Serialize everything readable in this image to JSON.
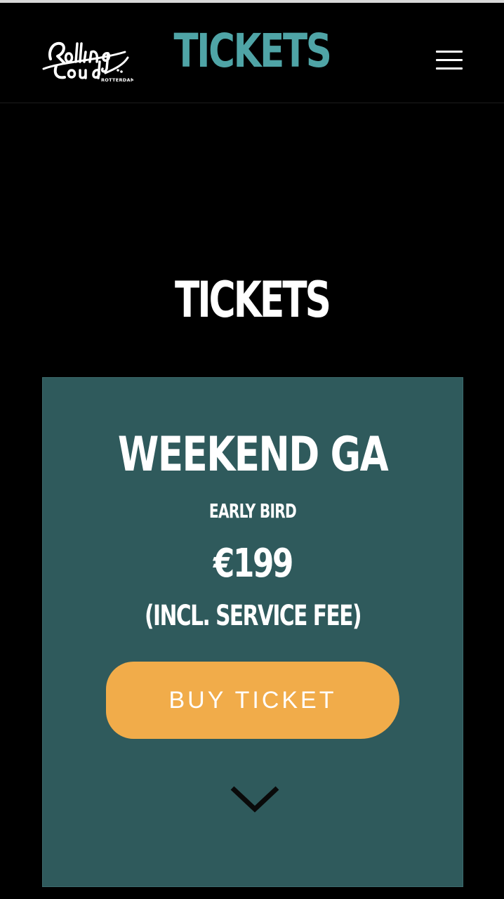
{
  "header": {
    "logo_alt": "Rolling Loud Rotterdam",
    "title": "TICKETS",
    "menu_icon": "hamburger-icon"
  },
  "main": {
    "section_title": "TICKETS",
    "ticket": {
      "name": "WEEKEND GA",
      "phase": "EARLY BIRD",
      "price": "€199",
      "fee_note": "(INCL. SERVICE FEE)",
      "buy_label": "BUY TICKET",
      "expand_icon": "chevron-down-icon"
    }
  },
  "colors": {
    "background": "#000000",
    "accent_teal": "#4fa4a6",
    "card": "#2f5a5c",
    "button": "#f1ac4a",
    "text": "#ffffff"
  }
}
